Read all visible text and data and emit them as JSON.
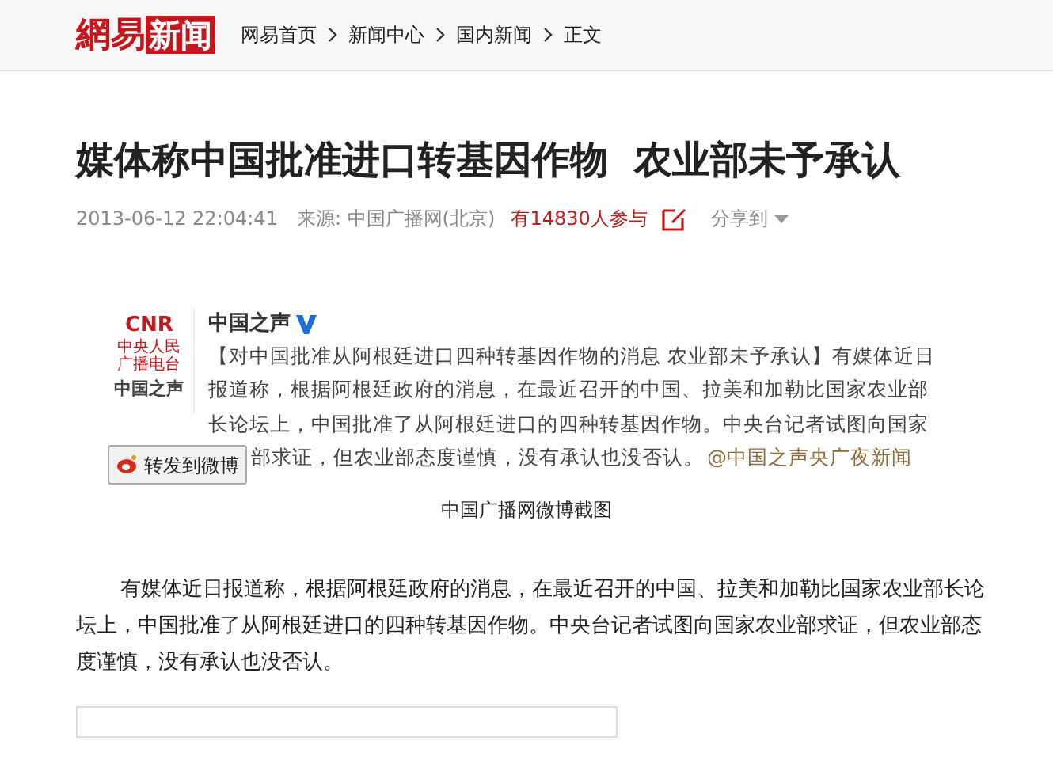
{
  "header": {
    "logo": {
      "left": "網易",
      "right": "新闻"
    },
    "breadcrumbs": [
      "网易首页",
      "新闻中心",
      "国内新闻",
      "正文"
    ]
  },
  "article": {
    "title": "媒体称中国批准进口转基因作物  农业部未予承认",
    "meta": {
      "time": "2013-06-12 22:04:41",
      "source": "来源: 中国广播网(北京)",
      "participants": "有14830人参与",
      "share": "分享到"
    },
    "weibo": {
      "avatar_top": "CNR",
      "avatar_small": "中央人民广播电台",
      "avatar_name": "中国之声",
      "name": "中国之声",
      "verified": true,
      "lines": [
        "【对中国批准从阿根廷进口四种转基因作物的消息 农业部未予承认】有媒体近日",
        "报道称，根据阿根廷政府的消息，在最近召开的中国、拉美和加勒比国家农业部",
        "长论坛上，中国批准了从阿根廷进口的四种转基因作物。中央台记者试图向国家",
        "部求证，但农业部态度谨慎，没有承认也没否认。"
      ],
      "mention": "@中国之声央广夜新闻",
      "forward_button": "转发到微博"
    },
    "caption": "中国广播网微博截图",
    "body": "有媒体近日报道称，根据阿根廷政府的消息，在最近召开的中国、拉美和加勒比国家农业部长论坛上，中国批准了从阿根廷进口的四种转基因作物。中央台记者试图向国家农业部求证，但农业部态度谨慎，没有承认也没否认。"
  }
}
